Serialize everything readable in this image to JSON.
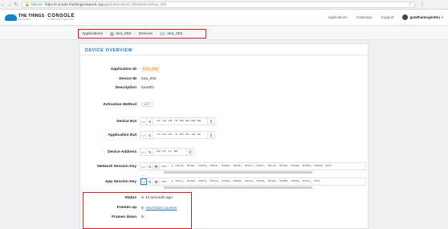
{
  "browser": {
    "secure_label": "Secure",
    "url_base": "https://console.thethingsnetwork.org",
    "url_path": "/applications/lora_002/devices/lora_002"
  },
  "header": {
    "brand": "THE THINGS",
    "brand_sub": "NETWORK",
    "console_title": "CONSOLE",
    "console_sub": "COMMUNITY EDITION",
    "nav": [
      "Applications",
      "Gateways",
      "Support"
    ],
    "user": "gowthamrajenthu"
  },
  "breadcrumb": {
    "items": [
      "Applications",
      "lora_002",
      "Devices",
      "lora_002"
    ],
    "separator": "›"
  },
  "overview": {
    "title": "DEVICE OVERVIEW",
    "application_id_label": "Application ID",
    "application_id": "lora_002",
    "device_id_label": "Device ID",
    "device_id": "lora_002",
    "description_label": "Description",
    "description": "lora002",
    "activation_label": "Activation Method",
    "activation": "ABP",
    "device_eui_label": "Device EUI",
    "device_eui": "12 34 56 78 AA AA AA AA",
    "app_eui_label": "Application EUI",
    "app_eui": "70 B3 D5 7E D0 01 18 4E",
    "dev_addr_label": "Device Address",
    "dev_addr": "26 01 1C B6",
    "nwk_key_label": "Network Session Key",
    "nwk_key": "{ 0x25, 0xAC, 0xE8, 0x5E, 0xA0, 0x5E, 0xE2, 0x2F, 0xC3, 0x48, 0x6A, 0x09, 0xD0, 0x1",
    "app_key_label": "App Session Key",
    "app_key": "{ 0xCC, 0x48, 0xF6, 0x33, 0x58, 0xAD, 0x52, 0x59, 0x82, 0x0B, 0x0D, 0x1C, 0x1",
    "btn_toggle": "<>",
    "btn_swap": "⇅",
    "btn_eye": "👁",
    "btn_copy": "⎘",
    "msb_label": "msb",
    "status_label": "Status",
    "status": "14 seconds ago",
    "frames_up_label": "Frames up",
    "frames_up": "0",
    "reset_link": "reset frame counters",
    "frames_down_label": "Frames down",
    "frames_down": "0"
  },
  "colors": {
    "accent": "#2a72b8",
    "highlight": "#d21f2b",
    "secure": "#1a9e4b"
  }
}
